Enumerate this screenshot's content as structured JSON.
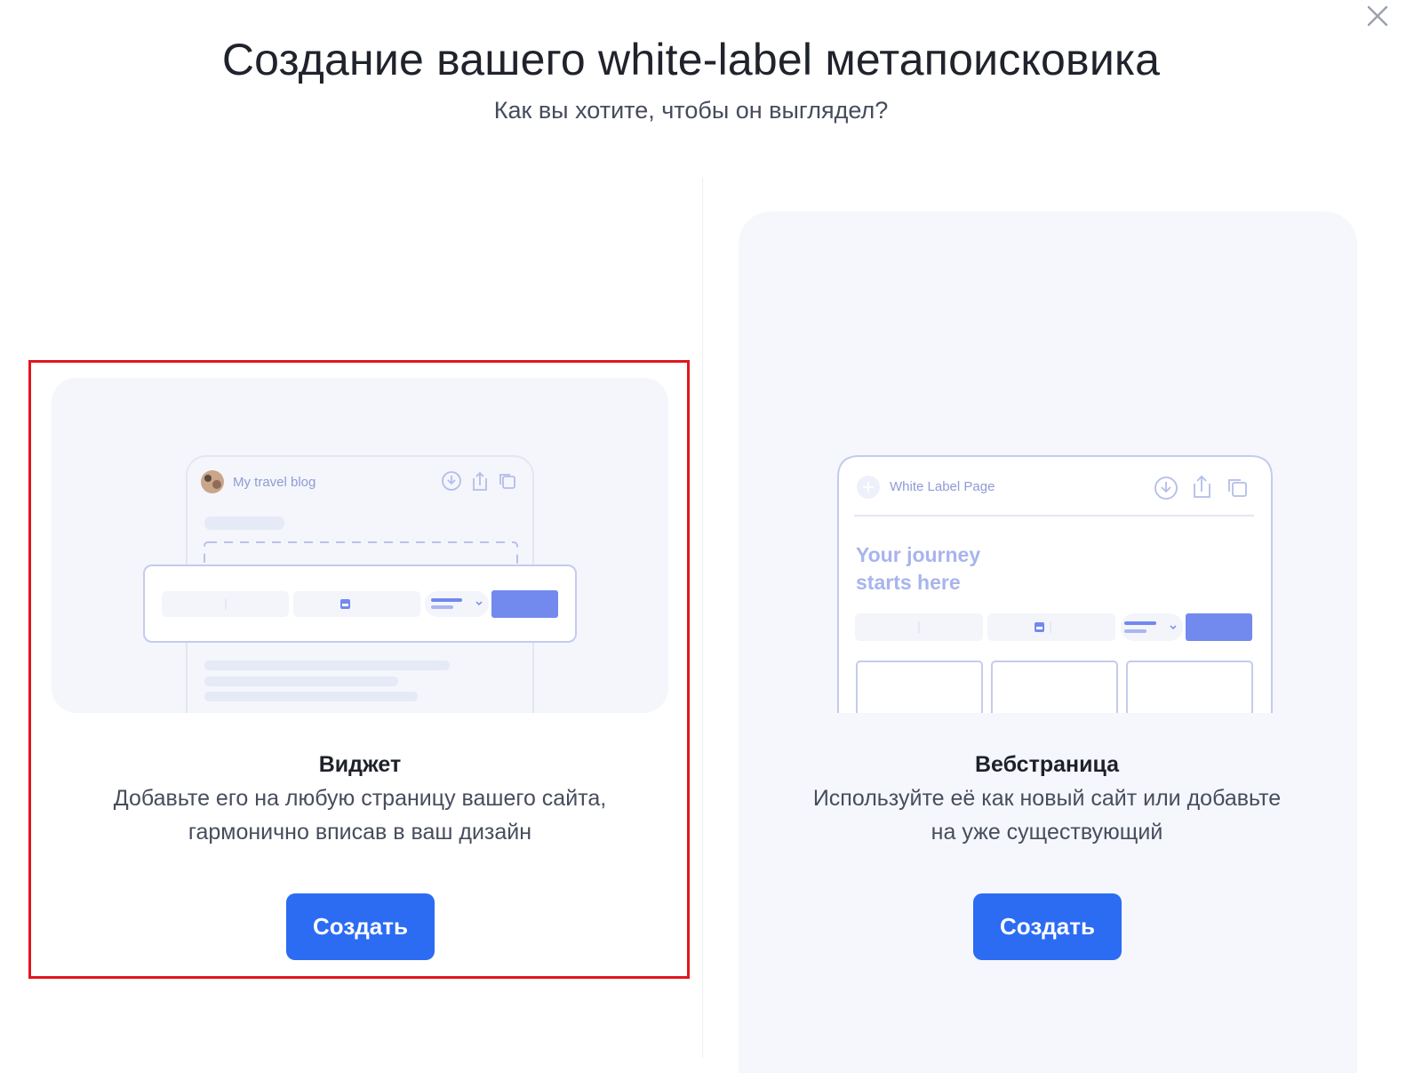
{
  "dialog": {
    "title": "Создание вашего white-label метапоисковика",
    "subtitle": "Как вы хотите, чтобы он выглядел?"
  },
  "cards": [
    {
      "title": "Виджет",
      "description_line1": "Добавьте его на любую страницу вашего сайта,",
      "description_line2": "гармонично вписав в ваш дизайн",
      "button_label": "Создать",
      "preview": {
        "site_name": "My travel blog"
      }
    },
    {
      "title": "Вебстраница",
      "description_line1": "Используйте её как новый сайт или добавьте",
      "description_line2": "на уже существующий",
      "button_label": "Создать",
      "preview": {
        "site_name": "White Label Page",
        "headline_line1": "Your journey",
        "headline_line2": "starts here"
      }
    }
  ],
  "colors": {
    "accent": "#2b6cf3",
    "selection_outline": "#e0161f",
    "preview_background": "#f4f6fb",
    "mock_accent": "#7289ee"
  },
  "icons": [
    "close-icon",
    "download-icon",
    "share-icon",
    "copy-icon",
    "calendar-icon",
    "chevron-down-icon",
    "avatar",
    "plus-icon"
  ]
}
